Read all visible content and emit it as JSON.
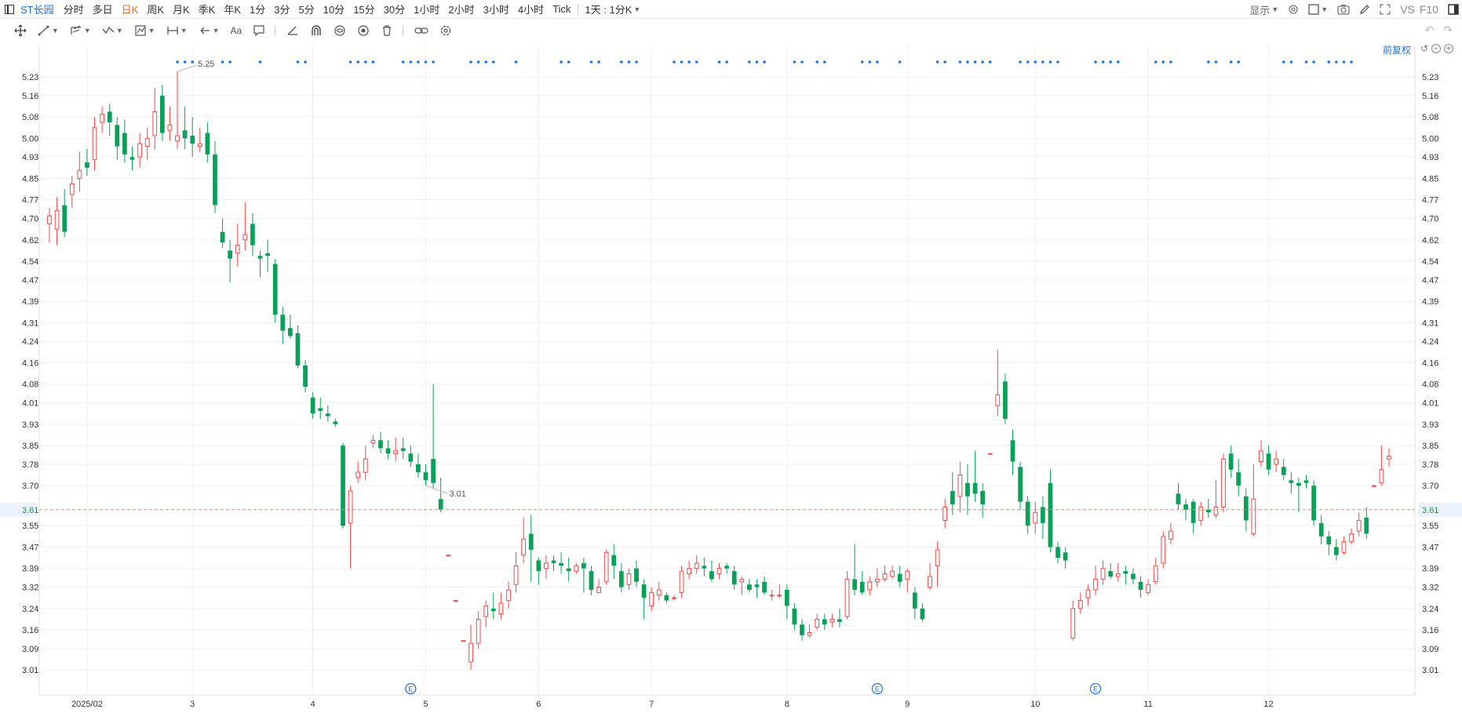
{
  "header": {
    "symbol": "ST长园",
    "periods": [
      "分时",
      "多日",
      "日K",
      "周K",
      "月K",
      "季K",
      "年K",
      "1分",
      "3分",
      "5分",
      "10分",
      "15分",
      "30分",
      "1小时",
      "2小时",
      "3小时",
      "4小时",
      "Tick"
    ],
    "active_period": "日K",
    "interval_select": "1天 : 1分K",
    "display_label": "显示",
    "vs_label": "VS",
    "f10_label": "F10"
  },
  "adjust_label": "前复权",
  "colors": {
    "up": "#f04848",
    "down": "#0aa05a",
    "accent": "#1a73e8",
    "price_line": "#f08c64"
  },
  "chart_data": {
    "type": "candlestick",
    "y_ticks": [
      "5.23",
      "5.16",
      "5.08",
      "5.00",
      "4.93",
      "4.85",
      "4.77",
      "4.70",
      "4.62",
      "4.54",
      "4.47",
      "4.39",
      "4.31",
      "4.24",
      "4.16",
      "4.08",
      "4.01",
      "3.93",
      "3.85",
      "3.78",
      "3.70",
      "3.61",
      "3.55",
      "3.47",
      "3.39",
      "3.32",
      "3.24",
      "3.16",
      "3.09",
      "3.01"
    ],
    "y_range": [
      2.94,
      5.33
    ],
    "x_labels": [
      {
        "label": "2025/02",
        "index": 5
      },
      {
        "label": "3",
        "index": 19
      },
      {
        "label": "4",
        "index": 35
      },
      {
        "label": "5",
        "index": 50
      },
      {
        "label": "6",
        "index": 65
      },
      {
        "label": "7",
        "index": 80
      },
      {
        "label": "8",
        "index": 98
      },
      {
        "label": "9",
        "index": 114
      },
      {
        "label": "10",
        "index": 131
      },
      {
        "label": "11",
        "index": 146
      },
      {
        "label": "12",
        "index": 162
      }
    ],
    "current_price": "3.61",
    "high_label": "5.25",
    "low_label": "3.01",
    "high_index": 17,
    "low_index": 50,
    "event_marker_indices": [
      48,
      110,
      139
    ],
    "event_marker_label": "E",
    "dot_marker_indices": [
      17,
      18,
      19,
      23,
      24,
      28,
      33,
      34,
      40,
      41,
      42,
      43,
      47,
      48,
      49,
      50,
      51,
      56,
      57,
      58,
      59,
      62,
      68,
      69,
      72,
      73,
      76,
      77,
      78,
      83,
      84,
      85,
      86,
      89,
      90,
      93,
      94,
      95,
      99,
      100,
      102,
      103,
      108,
      109,
      110,
      113,
      118,
      119,
      121,
      122,
      123,
      124,
      125,
      129,
      130,
      131,
      132,
      133,
      134,
      139,
      140,
      141,
      142,
      147,
      148,
      149,
      154,
      155,
      157,
      158,
      164,
      165,
      167,
      168,
      170,
      171,
      172,
      173
    ],
    "candles": [
      [
        4.68,
        4.71,
        4.74,
        4.61
      ],
      [
        4.66,
        4.73,
        4.78,
        4.6
      ],
      [
        4.75,
        4.65,
        4.81,
        4.63
      ],
      [
        4.79,
        4.83,
        4.86,
        4.74
      ],
      [
        4.85,
        4.88,
        4.95,
        4.8
      ],
      [
        4.91,
        4.89,
        4.96,
        4.86
      ],
      [
        4.92,
        5.04,
        5.08,
        4.88
      ],
      [
        5.06,
        5.09,
        5.12,
        5.02
      ],
      [
        5.1,
        5.06,
        5.13,
        5.01
      ],
      [
        5.05,
        4.97,
        5.08,
        4.92
      ],
      [
        5.02,
        4.94,
        5.07,
        4.91
      ],
      [
        4.93,
        4.92,
        4.97,
        4.88
      ],
      [
        4.93,
        4.98,
        5.02,
        4.89
      ],
      [
        4.97,
        5.0,
        5.04,
        4.92
      ],
      [
        5.01,
        5.1,
        5.19,
        4.96
      ],
      [
        5.16,
        5.02,
        5.2,
        4.99
      ],
      [
        5.03,
        5.05,
        5.12,
        4.99
      ],
      [
        4.99,
        5.01,
        5.25,
        4.96
      ],
      [
        5.03,
        5.0,
        5.12,
        4.96
      ],
      [
        5.01,
        4.98,
        5.08,
        4.93
      ],
      [
        4.97,
        4.98,
        5.04,
        4.95
      ],
      [
        5.02,
        4.94,
        5.06,
        4.91
      ],
      [
        4.94,
        4.75,
        4.99,
        4.72
      ],
      [
        4.65,
        4.61,
        4.7,
        4.59
      ],
      [
        4.58,
        4.55,
        4.62,
        4.46
      ],
      [
        4.57,
        4.6,
        4.68,
        4.52
      ],
      [
        4.62,
        4.64,
        4.76,
        4.58
      ],
      [
        4.68,
        4.6,
        4.72,
        4.56
      ],
      [
        4.56,
        4.55,
        4.58,
        4.48
      ],
      [
        4.57,
        4.56,
        4.62,
        4.5
      ],
      [
        4.53,
        4.34,
        4.55,
        4.31
      ],
      [
        4.34,
        4.28,
        4.37,
        4.23
      ],
      [
        4.29,
        4.26,
        4.34,
        4.25
      ],
      [
        4.27,
        4.15,
        4.3,
        4.14
      ],
      [
        4.15,
        4.07,
        4.17,
        4.05
      ],
      [
        4.03,
        3.97,
        4.05,
        3.95
      ],
      [
        3.99,
        3.98,
        4.03,
        3.95
      ],
      [
        3.97,
        3.96,
        4.0,
        3.94
      ],
      [
        3.94,
        3.93,
        3.95,
        3.92
      ],
      [
        3.85,
        3.55,
        3.86,
        3.54
      ],
      [
        3.56,
        3.68,
        3.7,
        3.39
      ],
      [
        3.73,
        3.75,
        3.79,
        3.71
      ],
      [
        3.75,
        3.8,
        3.85,
        3.72
      ],
      [
        3.86,
        3.87,
        3.89,
        3.84
      ],
      [
        3.87,
        3.84,
        3.9,
        3.82
      ],
      [
        3.84,
        3.82,
        3.87,
        3.8
      ],
      [
        3.82,
        3.83,
        3.88,
        3.79
      ],
      [
        3.84,
        3.83,
        3.88,
        3.8
      ],
      [
        3.82,
        3.79,
        3.85,
        3.77
      ],
      [
        3.78,
        3.75,
        3.82,
        3.73
      ],
      [
        3.75,
        3.72,
        3.78,
        3.7
      ],
      [
        3.8,
        3.71,
        4.08,
        3.69
      ],
      [
        3.65,
        3.61,
        3.73,
        3.6
      ],
      [
        3.44,
        3.44,
        3.44,
        3.44
      ],
      [
        3.27,
        3.27,
        3.27,
        3.27
      ],
      [
        3.12,
        3.12,
        3.12,
        3.12
      ],
      [
        3.04,
        3.11,
        3.18,
        3.01
      ],
      [
        3.11,
        3.2,
        3.23,
        3.09
      ],
      [
        3.21,
        3.25,
        3.27,
        3.17
      ],
      [
        3.24,
        3.23,
        3.3,
        3.2
      ],
      [
        3.22,
        3.26,
        3.3,
        3.2
      ],
      [
        3.27,
        3.31,
        3.34,
        3.24
      ],
      [
        3.33,
        3.4,
        3.45,
        3.3
      ],
      [
        3.44,
        3.5,
        3.58,
        3.41
      ],
      [
        3.52,
        3.46,
        3.59,
        3.34
      ],
      [
        3.42,
        3.38,
        3.43,
        3.33
      ],
      [
        3.39,
        3.41,
        3.44,
        3.35
      ],
      [
        3.42,
        3.41,
        3.44,
        3.38
      ],
      [
        3.41,
        3.4,
        3.45,
        3.37
      ],
      [
        3.39,
        3.38,
        3.43,
        3.34
      ],
      [
        3.38,
        3.4,
        3.41,
        3.37
      ],
      [
        3.41,
        3.39,
        3.43,
        3.3
      ],
      [
        3.38,
        3.31,
        3.4,
        3.29
      ],
      [
        3.3,
        3.32,
        3.35,
        3.3
      ],
      [
        3.34,
        3.45,
        3.46,
        3.33
      ],
      [
        3.44,
        3.4,
        3.48,
        3.35
      ],
      [
        3.38,
        3.32,
        3.41,
        3.3
      ],
      [
        3.33,
        3.37,
        3.39,
        3.31
      ],
      [
        3.39,
        3.34,
        3.42,
        3.32
      ],
      [
        3.33,
        3.28,
        3.35,
        3.2
      ],
      [
        3.25,
        3.3,
        3.32,
        3.23
      ],
      [
        3.29,
        3.31,
        3.34,
        3.27
      ],
      [
        3.29,
        3.27,
        3.3,
        3.26
      ],
      [
        3.28,
        3.28,
        3.29,
        3.27
      ],
      [
        3.3,
        3.38,
        3.4,
        3.28
      ],
      [
        3.37,
        3.39,
        3.42,
        3.35
      ],
      [
        3.39,
        3.41,
        3.44,
        3.37
      ],
      [
        3.4,
        3.39,
        3.43,
        3.36
      ],
      [
        3.38,
        3.35,
        3.42,
        3.34
      ],
      [
        3.37,
        3.39,
        3.41,
        3.35
      ],
      [
        3.4,
        3.39,
        3.41,
        3.37
      ],
      [
        3.38,
        3.33,
        3.4,
        3.31
      ],
      [
        3.34,
        3.35,
        3.36,
        3.29
      ],
      [
        3.33,
        3.31,
        3.35,
        3.3
      ],
      [
        3.33,
        3.32,
        3.35,
        3.28
      ],
      [
        3.34,
        3.3,
        3.36,
        3.29
      ],
      [
        3.29,
        3.29,
        3.31,
        3.27
      ],
      [
        3.29,
        3.29,
        3.33,
        3.28
      ],
      [
        3.31,
        3.25,
        3.33,
        3.2
      ],
      [
        3.24,
        3.18,
        3.26,
        3.16
      ],
      [
        3.18,
        3.14,
        3.2,
        3.12
      ],
      [
        3.14,
        3.15,
        3.18,
        3.13
      ],
      [
        3.17,
        3.2,
        3.22,
        3.16
      ],
      [
        3.2,
        3.18,
        3.22,
        3.16
      ],
      [
        3.19,
        3.2,
        3.22,
        3.17
      ],
      [
        3.2,
        3.19,
        3.24,
        3.17
      ],
      [
        3.21,
        3.35,
        3.38,
        3.2
      ],
      [
        3.35,
        3.31,
        3.48,
        3.29
      ],
      [
        3.34,
        3.3,
        3.38,
        3.29
      ],
      [
        3.31,
        3.34,
        3.36,
        3.29
      ],
      [
        3.34,
        3.35,
        3.39,
        3.32
      ],
      [
        3.35,
        3.37,
        3.4,
        3.34
      ],
      [
        3.36,
        3.38,
        3.4,
        3.35
      ],
      [
        3.37,
        3.34,
        3.4,
        3.32
      ],
      [
        3.35,
        3.38,
        3.39,
        3.3
      ],
      [
        3.3,
        3.24,
        3.32,
        3.2
      ],
      [
        3.24,
        3.2,
        3.26,
        3.19
      ],
      [
        3.32,
        3.36,
        3.41,
        3.31
      ],
      [
        3.4,
        3.46,
        3.49,
        3.32
      ],
      [
        3.57,
        3.62,
        3.65,
        3.54
      ],
      [
        3.68,
        3.63,
        3.75,
        3.59
      ],
      [
        3.66,
        3.74,
        3.79,
        3.6
      ],
      [
        3.71,
        3.66,
        3.78,
        3.59
      ],
      [
        3.71,
        3.67,
        3.83,
        3.64
      ],
      [
        3.68,
        3.63,
        3.71,
        3.58
      ],
      [
        3.82,
        3.82,
        3.82,
        3.82
      ],
      [
        4.0,
        4.04,
        4.21,
        3.96
      ],
      [
        4.09,
        3.95,
        4.12,
        3.93
      ],
      [
        3.87,
        3.79,
        3.91,
        3.74
      ],
      [
        3.77,
        3.64,
        3.79,
        3.61
      ],
      [
        3.64,
        3.55,
        3.66,
        3.52
      ],
      [
        3.56,
        3.6,
        3.64,
        3.52
      ],
      [
        3.62,
        3.56,
        3.66,
        3.5
      ],
      [
        3.71,
        3.47,
        3.76,
        3.45
      ],
      [
        3.47,
        3.43,
        3.49,
        3.41
      ],
      [
        3.45,
        3.42,
        3.47,
        3.39
      ],
      [
        3.13,
        3.24,
        3.27,
        3.12
      ],
      [
        3.24,
        3.27,
        3.3,
        3.22
      ],
      [
        3.28,
        3.31,
        3.33,
        3.25
      ],
      [
        3.31,
        3.35,
        3.4,
        3.29
      ],
      [
        3.35,
        3.39,
        3.42,
        3.33
      ],
      [
        3.38,
        3.36,
        3.41,
        3.35
      ],
      [
        3.36,
        3.37,
        3.41,
        3.34
      ],
      [
        3.38,
        3.37,
        3.4,
        3.33
      ],
      [
        3.37,
        3.35,
        3.39,
        3.33
      ],
      [
        3.34,
        3.31,
        3.36,
        3.28
      ],
      [
        3.3,
        3.33,
        3.35,
        3.29
      ],
      [
        3.34,
        3.4,
        3.43,
        3.33
      ],
      [
        3.41,
        3.51,
        3.53,
        3.39
      ],
      [
        3.5,
        3.53,
        3.56,
        3.48
      ],
      [
        3.67,
        3.63,
        3.71,
        3.61
      ],
      [
        3.63,
        3.61,
        3.65,
        3.57
      ],
      [
        3.64,
        3.56,
        3.65,
        3.52
      ],
      [
        3.57,
        3.62,
        3.64,
        3.55
      ],
      [
        3.61,
        3.6,
        3.65,
        3.58
      ],
      [
        3.59,
        3.62,
        3.72,
        3.58
      ],
      [
        3.62,
        3.8,
        3.82,
        3.6
      ],
      [
        3.82,
        3.76,
        3.85,
        3.73
      ],
      [
        3.75,
        3.7,
        3.8,
        3.66
      ],
      [
        3.66,
        3.57,
        3.69,
        3.53
      ],
      [
        3.52,
        3.65,
        3.78,
        3.51
      ],
      [
        3.79,
        3.83,
        3.87,
        3.77
      ],
      [
        3.82,
        3.76,
        3.85,
        3.74
      ],
      [
        3.78,
        3.8,
        3.83,
        3.75
      ],
      [
        3.77,
        3.74,
        3.8,
        3.72
      ],
      [
        3.72,
        3.71,
        3.75,
        3.67
      ],
      [
        3.71,
        3.7,
        3.73,
        3.6
      ],
      [
        3.72,
        3.71,
        3.74,
        3.69
      ],
      [
        3.7,
        3.57,
        3.72,
        3.55
      ],
      [
        3.56,
        3.51,
        3.59,
        3.48
      ],
      [
        3.51,
        3.48,
        3.53,
        3.44
      ],
      [
        3.47,
        3.44,
        3.5,
        3.42
      ],
      [
        3.45,
        3.49,
        3.51,
        3.44
      ],
      [
        3.49,
        3.52,
        3.54,
        3.48
      ],
      [
        3.53,
        3.57,
        3.6,
        3.51
      ],
      [
        3.58,
        3.52,
        3.62,
        3.5
      ],
      [
        3.7,
        3.7,
        3.7,
        3.7
      ],
      [
        3.71,
        3.76,
        3.85,
        3.7
      ],
      [
        3.8,
        3.81,
        3.84,
        3.77
      ]
    ]
  }
}
